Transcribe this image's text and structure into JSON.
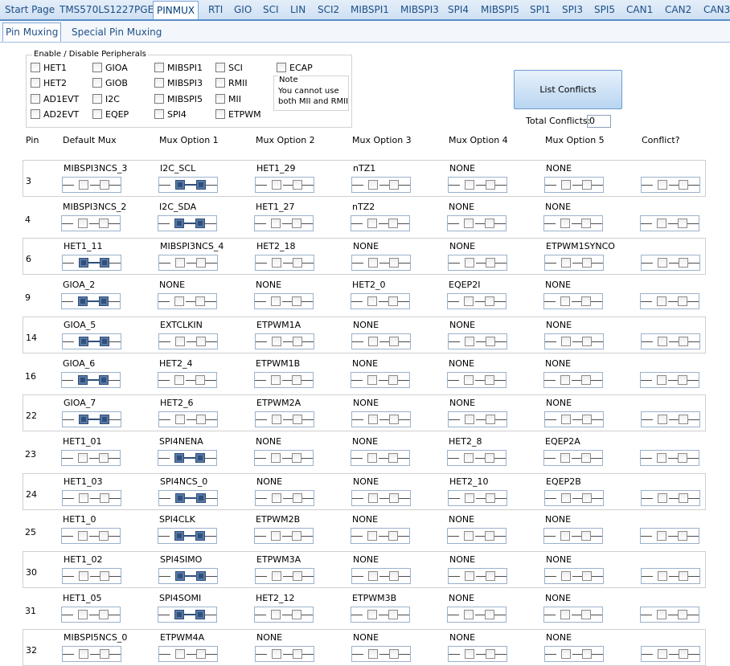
{
  "tabs": [
    "Start Page",
    "TMS570LS1227PGE",
    "PINMUX",
    "RTI",
    "GIO",
    "SCI",
    "LIN",
    "SCI2",
    "MIBSPI1",
    "MIBSPI3",
    "SPI4",
    "MIBSPI5",
    "SPI1",
    "SPI3",
    "SPI5",
    "CAN1",
    "CAN2",
    "CAN3"
  ],
  "active_tab": "PINMUX",
  "subtabs": [
    "Pin Muxing",
    "Special Pin Muxing"
  ],
  "peripherals": {
    "title": "Enable / Disable Peripherals",
    "items": [
      "HET1",
      "GIOA",
      "MIBSPI1",
      "SCI",
      "ECAP",
      "HET2",
      "GIOB",
      "MIBSPI3",
      "RMII",
      "AD1EVT",
      "I2C",
      "MIBSPI5",
      "MII",
      "AD2EVT",
      "EQEP",
      "SPI4",
      "ETPWM"
    ],
    "note_title": "Note",
    "note_text": "You cannot use both MII and RMII"
  },
  "buttons": {
    "list_conflicts": "List Conflicts"
  },
  "total_conflicts": {
    "label": "Total Conflicts:",
    "value": "0"
  },
  "columns": [
    "Pin",
    "Default Mux",
    "Mux Option 1",
    "Mux Option 2",
    "Mux Option 3",
    "Mux Option 4",
    "Mux Option 5",
    "Conflict?"
  ],
  "rows": [
    {
      "pin": "3",
      "options": [
        "MIBSPI3NCS_3",
        "I2C_SCL",
        "HET1_29",
        "nTZ1",
        "NONE",
        "NONE"
      ],
      "selected": 1
    },
    {
      "pin": "4",
      "options": [
        "MIBSPI3NCS_2",
        "I2C_SDA",
        "HET1_27",
        "nTZ2",
        "NONE",
        "NONE"
      ],
      "selected": 1
    },
    {
      "pin": "6",
      "options": [
        "HET1_11",
        "MIBSPI3NCS_4",
        "HET2_18",
        "NONE",
        "NONE",
        "ETPWM1SYNCO"
      ],
      "selected": 0
    },
    {
      "pin": "9",
      "options": [
        "GIOA_2",
        "NONE",
        "NONE",
        "HET2_0",
        "EQEP2I",
        "NONE"
      ],
      "selected": 0
    },
    {
      "pin": "14",
      "options": [
        "GIOA_5",
        "EXTCLKIN",
        "ETPWM1A",
        "NONE",
        "NONE",
        "NONE"
      ],
      "selected": 0
    },
    {
      "pin": "16",
      "options": [
        "GIOA_6",
        "HET2_4",
        "ETPWM1B",
        "NONE",
        "NONE",
        "NONE"
      ],
      "selected": 0
    },
    {
      "pin": "22",
      "options": [
        "GIOA_7",
        "HET2_6",
        "ETPWM2A",
        "NONE",
        "NONE",
        "NONE"
      ],
      "selected": 0
    },
    {
      "pin": "23",
      "options": [
        "HET1_01",
        "SPI4NENA",
        "NONE",
        "NONE",
        "HET2_8",
        "EQEP2A"
      ],
      "selected": 1
    },
    {
      "pin": "24",
      "options": [
        "HET1_03",
        "SPI4NCS_0",
        "NONE",
        "NONE",
        "HET2_10",
        "EQEP2B"
      ],
      "selected": 1
    },
    {
      "pin": "25",
      "options": [
        "HET1_0",
        "SPI4CLK",
        "ETPWM2B",
        "NONE",
        "NONE",
        "NONE"
      ],
      "selected": 1
    },
    {
      "pin": "30",
      "options": [
        "HET1_02",
        "SPI4SIMO",
        "ETPWM3A",
        "NONE",
        "NONE",
        "NONE"
      ],
      "selected": 1
    },
    {
      "pin": "31",
      "options": [
        "HET1_05",
        "SPI4SOMI",
        "HET2_12",
        "ETPWM3B",
        "NONE",
        "NONE"
      ],
      "selected": 1
    },
    {
      "pin": "32",
      "options": [
        "MIBSPI5NCS_0",
        "ETPWM4A",
        "NONE",
        "NONE",
        "NONE",
        "NONE"
      ],
      "selected": -1
    }
  ]
}
